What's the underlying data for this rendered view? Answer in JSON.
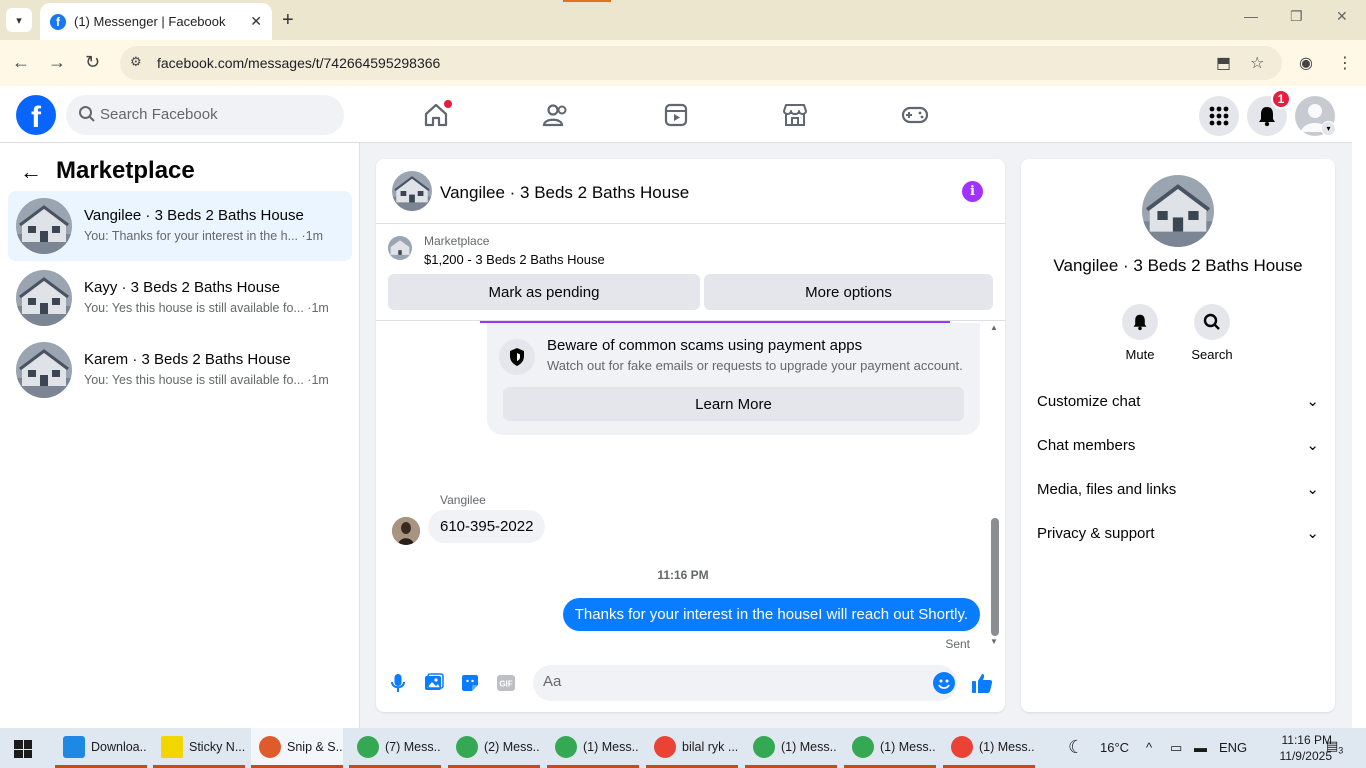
{
  "browser": {
    "tab_title": "(1) Messenger | Facebook",
    "url": "facebook.com/messages/t/742664595298366"
  },
  "fb": {
    "search_placeholder": "Search Facebook",
    "notifications_count": "1"
  },
  "sidebar": {
    "title": "Marketplace",
    "conversations": [
      {
        "name": "Vangilee · 3 Beds 2 Baths House",
        "preview": "You: Thanks for your interest in the h... ·1m",
        "active": true
      },
      {
        "name": "Kayy · 3 Beds 2 Baths House",
        "preview": "You: Yes this house is still available fo... ·1m",
        "active": false
      },
      {
        "name": "Karem · 3 Beds 2 Baths House",
        "preview": "You: Yes this house is still available fo... ·1m",
        "active": false
      }
    ]
  },
  "chat": {
    "title": "Vangilee · 3 Beds 2 Baths House",
    "marketplace_label": "Marketplace",
    "listing": "$1,200 - 3 Beds 2 Baths House",
    "mark_pending": "Mark as pending",
    "more_options": "More options",
    "scam_title": "Beware of common scams using payment apps",
    "scam_sub": "Watch out for fake emails or requests to upgrade your payment account.",
    "learn_more": "Learn More",
    "sender": "Vangilee",
    "incoming": "610-395-2022",
    "timestamp": "11:16 PM",
    "outgoing": "Thanks for your interest in the houseI will reach out Shortly.",
    "sent": "Sent",
    "composer_placeholder": "Aa"
  },
  "info_panel": {
    "title": "Vangilee · 3 Beds 2 Baths House",
    "mute": "Mute",
    "search": "Search",
    "rows": [
      "Customize chat",
      "Chat members",
      "Media, files and links",
      "Privacy & support"
    ]
  },
  "taskbar": {
    "items": [
      "Downloa...",
      "Sticky N...",
      "Snip & S...",
      "(7) Mess...",
      "(2) Mess...",
      "(1) Mess...",
      "bilal ryk ...",
      "(1) Mess...",
      "(1) Mess...",
      "(1) Mess..."
    ],
    "weather": "16°C",
    "lang": "ENG",
    "time": "11:16 PM",
    "date": "11/9/2025",
    "notif_count": "3"
  },
  "colors": {
    "fb_blue": "#0866ff",
    "outgoing_bubble": "#0a7cff",
    "info_purple": "#a033ff",
    "badge_red": "#e41e3f"
  }
}
